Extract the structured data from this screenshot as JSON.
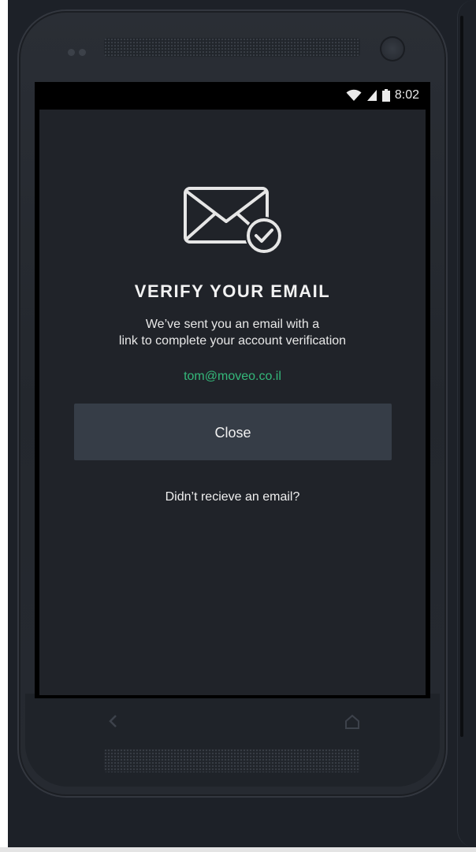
{
  "status_bar": {
    "time": "8:02",
    "wifi_icon": "wifi-icon",
    "signal_icon": "cell-signal-icon",
    "battery_icon": "battery-icon"
  },
  "verify": {
    "icon": "email-verified-icon",
    "title": "VERIFY YOUR EMAIL",
    "subtitle_line1": "We’ve sent you an email with a",
    "subtitle_line2": "link to complete your account verification",
    "email": "tom@moveo.co.il",
    "close_label": "Close",
    "resend_label": "Didn’t recieve an email?"
  },
  "nav": {
    "back_icon": "back-arrow-icon",
    "home_icon": "home-icon"
  },
  "colors": {
    "background": "#202329",
    "email_accent": "#34b87a",
    "button_bg": "#363d47",
    "text": "#f0f0f0"
  }
}
